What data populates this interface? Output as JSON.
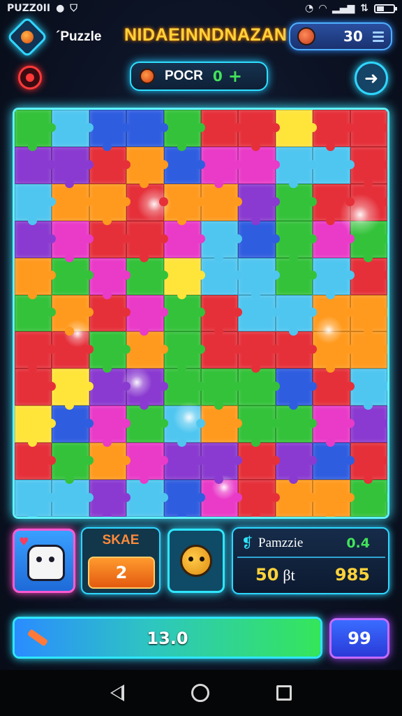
{
  "status_bar": {
    "app_label": "PUZZ0II"
  },
  "header": {
    "app_name": "´Puzzle",
    "level_title": "NIDAEINNDNAZAN",
    "score": "30"
  },
  "powerup": {
    "label": "POCR",
    "count": "0",
    "plus": "+"
  },
  "board": {
    "columns": 10,
    "rows": 11,
    "colors": {
      "r": "#e5303a",
      "o": "#ff9a1e",
      "y": "#ffe43a",
      "g": "#34c23a",
      "G": "#1fa23a",
      "b": "#2f5de0",
      "c": "#4fc6f0",
      "p": "#8a3ad0",
      "m": "#e93ac8",
      "t": "#2ea6a0"
    },
    "layout": [
      "gcbbgrryrr",
      "pprobmmccr",
      "cooroopgrr",
      "pmrrmcbgmg",
      "ogmgyccgcr",
      "gormgrccoo",
      "rrgogrrroo",
      "ryppgggbrc",
      "ybmgcoggmp",
      "rgompprpbr",
      "ccpcbmroog"
    ]
  },
  "cards": {
    "score_label": "SKAE",
    "score_value": "2"
  },
  "info": {
    "name": "Pamzzie",
    "ratio": "0.4",
    "stat": "50",
    "stat_unit": "βt",
    "best": "985"
  },
  "progress": {
    "value": "13.0",
    "fill_fraction": 1.0
  },
  "counter": "99",
  "colors": {
    "accent": "#2fd6ff",
    "gold": "#ffd23a",
    "green": "#42e35a"
  }
}
